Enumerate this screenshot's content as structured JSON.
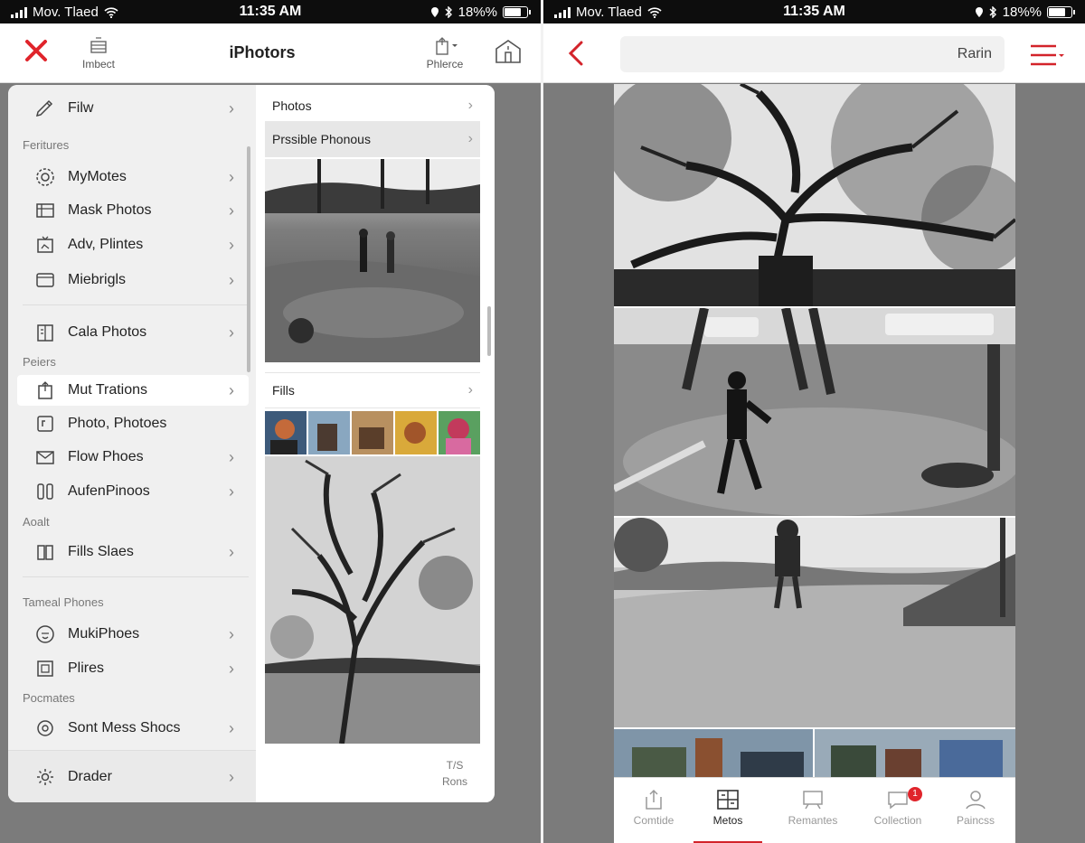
{
  "status_bar": {
    "left": {
      "carrier": "Mov. Tlaed",
      "wifi_icon": "wifi-icon"
    },
    "time": "11:35 AM",
    "right": {
      "battery_text": "18%%",
      "battery_level_percent": 80
    }
  },
  "status_bar_right": {
    "left": {
      "carrier": "Mov. Tlaed"
    },
    "time": "11:35 AM",
    "right": {
      "battery_text": "18%%"
    }
  },
  "left_screen": {
    "nav": {
      "close_icon": "close-x-icon",
      "import_label": "Imbect",
      "title": "iPhotors",
      "share_label": "Phlerce"
    },
    "menu": {
      "top_item": "Filw",
      "sections": [
        {
          "label": "Feritures",
          "items": [
            "MyMotes",
            "Mask Photos",
            "Adv, Plintes",
            "Miebrigls"
          ]
        },
        {
          "label": "",
          "items": [
            "Cala Photos"
          ]
        },
        {
          "label": "Peiers",
          "items": [
            "Mut Trations",
            "Photo, Photoes",
            "Flow Phoes",
            "AufenPinoos"
          ]
        },
        {
          "label": "Aoalt",
          "items": [
            "Fills Slaes"
          ]
        },
        {
          "label": "Tameal Phones",
          "items": [
            "MukiPhoes",
            "Plires"
          ]
        },
        {
          "label": "Pocmates",
          "items": [
            "Sont Mess Shocs"
          ]
        }
      ],
      "active_item": "Mut Trations",
      "bottom_item": "Drader"
    },
    "photos_column": {
      "header": "Photos",
      "subheader": "Prssible Phonous",
      "section2": "Fills",
      "bottom_button_top": "T/S",
      "bottom_button_bottom": "Rons"
    }
  },
  "right_screen": {
    "nav": {
      "search_value": "Rarin"
    },
    "tabs": [
      {
        "label": "Comtide"
      },
      {
        "label": "Metos",
        "active": true
      },
      {
        "label": "Remantes"
      },
      {
        "label": "Collection",
        "badge": "1"
      },
      {
        "label": "Paincss"
      }
    ]
  },
  "colors": {
    "accent_red": "#d3232a",
    "panel_bg": "#f0f0f0"
  }
}
